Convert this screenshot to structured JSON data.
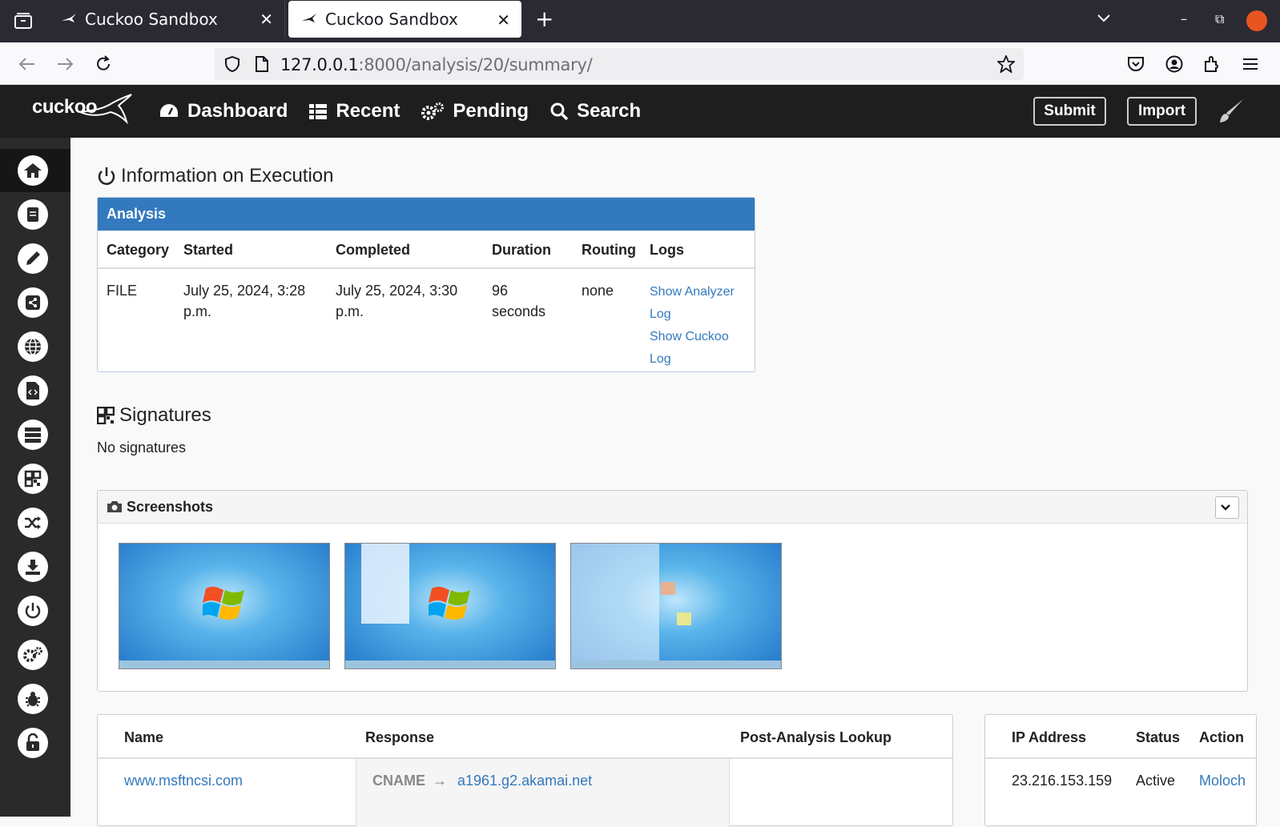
{
  "browser": {
    "tabs": [
      {
        "title": "Cuckoo Sandbox",
        "active": false
      },
      {
        "title": "Cuckoo Sandbox",
        "active": true
      }
    ],
    "url_host": "127.0.0.1",
    "url_rest": ":8000/analysis/20/summary/"
  },
  "header": {
    "logo": "cuckoo",
    "nav": [
      {
        "label": "Dashboard",
        "icon": "dashboard-icon"
      },
      {
        "label": "Recent",
        "icon": "list-icon"
      },
      {
        "label": "Pending",
        "icon": "gears-icon"
      },
      {
        "label": "Search",
        "icon": "search-icon"
      }
    ],
    "submit_label": "Submit",
    "import_label": "Import"
  },
  "sidebar": {
    "icons": [
      "home-icon",
      "book-icon",
      "pencil-icon",
      "share-icon",
      "globe-icon",
      "file-code-icon",
      "server-icon",
      "qrcode-icon",
      "random-icon",
      "download-icon",
      "power-icon",
      "gears-icon",
      "bug-icon",
      "unlock-icon"
    ]
  },
  "execution": {
    "title": "Information on Execution",
    "panel_title": "Analysis",
    "headers": [
      "Category",
      "Started",
      "Completed",
      "Duration",
      "Routing",
      "Logs"
    ],
    "category": "FILE",
    "started_line1": "July 25, 2024, 3:28",
    "started_line2": "p.m.",
    "completed_line1": "July 25, 2024, 3:30",
    "completed_line2": "p.m.",
    "duration_line1": "96",
    "duration_line2": "seconds",
    "routing": "none",
    "log1_line1": "Show Analyzer",
    "log1_line2": "Log",
    "log2_line1": "Show Cuckoo",
    "log2_line2": "Log"
  },
  "signatures": {
    "title": "Signatures",
    "empty_text": "No signatures"
  },
  "screenshots": {
    "title": "Screenshots",
    "count": 3
  },
  "dns": {
    "headers": [
      "Name",
      "Response",
      "Post-Analysis Lookup"
    ],
    "rows": [
      {
        "name": "www.msftncsi.com",
        "type": "CNAME",
        "value": "a1961.g2.akamai.net",
        "lookup": ""
      }
    ]
  },
  "hosts": {
    "headers": [
      "IP Address",
      "Status",
      "Action"
    ],
    "rows": [
      {
        "ip": "23.216.153.159",
        "status": "Active",
        "action": "Moloch"
      }
    ]
  }
}
